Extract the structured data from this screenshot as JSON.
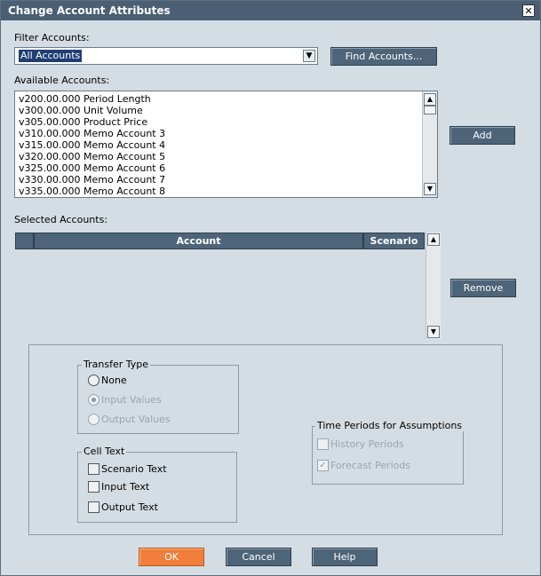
{
  "window": {
    "title": "Change Account Attributes",
    "close_glyph": "✕"
  },
  "filter": {
    "label": "Filter Accounts:",
    "selected": "All Accounts",
    "find_button": "Find Accounts..."
  },
  "available": {
    "label": "Available Accounts:",
    "items": [
      "v200.00.000 Period Length",
      "v300.00.000 Unit Volume",
      "v305.00.000 Product Price",
      "v310.00.000 Memo Account 3",
      "v315.00.000 Memo Account 4",
      "v320.00.000 Memo Account 5",
      "v325.00.000 Memo Account 6",
      "v330.00.000 Memo Account 7",
      "v335.00.000 Memo Account 8"
    ],
    "add_button": "Add"
  },
  "selected": {
    "label": "Selected Accounts:",
    "columns": [
      "Account",
      "Scenario"
    ],
    "remove_button": "Remove"
  },
  "transfer_type": {
    "legend": "Transfer Type",
    "options": [
      {
        "label": "None",
        "selected": false,
        "enabled": true
      },
      {
        "label": "Input Values",
        "selected": true,
        "enabled": false
      },
      {
        "label": "Output Values",
        "selected": false,
        "enabled": false
      }
    ]
  },
  "cell_text": {
    "legend": "Cell Text",
    "options": [
      {
        "label": "Scenario Text",
        "checked": false
      },
      {
        "label": "Input Text",
        "checked": false
      },
      {
        "label": "Output Text",
        "checked": false
      }
    ]
  },
  "time_periods": {
    "legend": "Time Periods for Assumptions",
    "options": [
      {
        "label": "History Periods",
        "checked": false,
        "enabled": false
      },
      {
        "label": "Forecast Periods",
        "checked": true,
        "enabled": false
      }
    ]
  },
  "footer": {
    "ok": "OK",
    "cancel": "Cancel",
    "help": "Help"
  },
  "glyphs": {
    "up": "▲",
    "down": "▼",
    "check": "✓"
  }
}
